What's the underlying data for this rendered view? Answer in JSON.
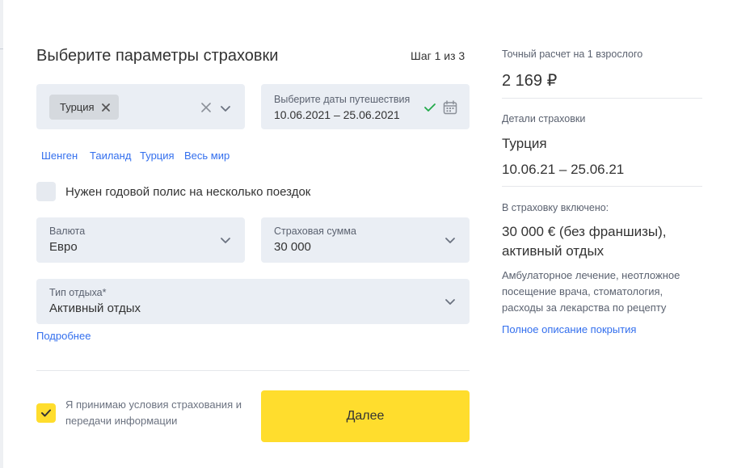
{
  "header": {
    "title": "Выберите параметры страховки",
    "step": "Шаг 1 из 3"
  },
  "country": {
    "selected_chip": "Турция"
  },
  "dates": {
    "label": "Выберите даты путешествия",
    "value": "10.06.2021 – 25.06.2021"
  },
  "quick_countries": [
    "Шенген",
    "Таиланд",
    "Турция",
    "Весь мир"
  ],
  "annual_policy": {
    "label": "Нужен годовой полис на несколько поездок",
    "checked": false
  },
  "currency": {
    "label": "Валюта",
    "value": "Евро"
  },
  "insured_sum": {
    "label": "Страховая сумма",
    "value": "30 000"
  },
  "rest_type": {
    "label": "Тип отдыха*",
    "value": "Активный отдых"
  },
  "more_link": "Подробнее",
  "agreement": {
    "text": "Я принимаю условия страхования и передачи информации",
    "checked": true
  },
  "next_button": "Далее",
  "summary": {
    "price_label": "Точный расчет на 1 взрослого",
    "price": "2 169 ₽",
    "details_label": "Детали страховки",
    "country": "Турция",
    "dates": "10.06.21 – 25.06.21",
    "included_label": "В страховку включено:",
    "coverage": "30 000 € (без франшизы), активный отдых",
    "coverage_desc": "Амбулаторное лечение, неотложное посещение врача, стоматология, расходы за лекарства по рецепту",
    "full_link": "Полное описание покрытия"
  },
  "colors": {
    "accent_yellow": "#ffdd2d",
    "link_blue": "#336fee",
    "field_bg": "#eaeef4",
    "check_green": "#22a94a"
  },
  "icons": {
    "chip_remove": "close-icon",
    "clear": "close-icon",
    "dropdown": "chevron-down-icon",
    "dates_ok": "check-icon",
    "calendar": "calendar-icon",
    "agree": "check-icon"
  }
}
